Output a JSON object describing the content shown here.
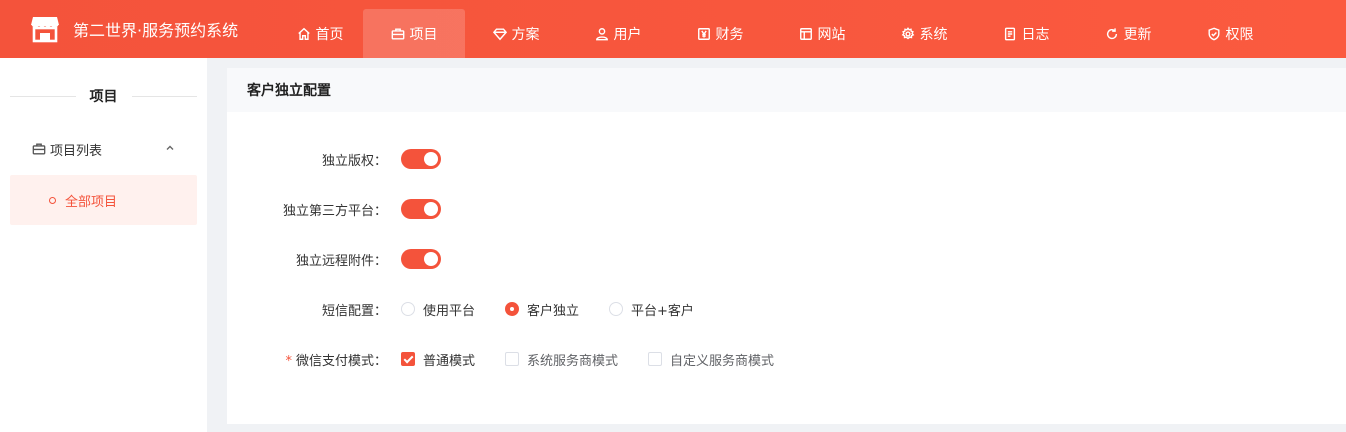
{
  "brand": {
    "title": "第二世界·服务预约系统"
  },
  "nav": {
    "items": [
      {
        "label": "首页",
        "icon": "home-icon"
      },
      {
        "label": "项目",
        "icon": "briefcase-icon",
        "active": true
      },
      {
        "label": "方案",
        "icon": "diamond-icon"
      },
      {
        "label": "用户",
        "icon": "user-icon"
      },
      {
        "label": "财务",
        "icon": "yen-icon"
      },
      {
        "label": "网站",
        "icon": "layout-icon"
      },
      {
        "label": "系统",
        "icon": "gear-icon"
      },
      {
        "label": "日志",
        "icon": "document-icon"
      },
      {
        "label": "更新",
        "icon": "refresh-icon"
      },
      {
        "label": "权限",
        "icon": "shield-icon"
      }
    ]
  },
  "sidebar": {
    "title": "项目",
    "group": {
      "label": "项目列表",
      "icon": "briefcase-icon",
      "expanded": true
    },
    "sub_item": {
      "label": "全部项目",
      "active": true
    }
  },
  "panel": {
    "title": "客户独立配置",
    "switches": [
      {
        "label": "独立版权：",
        "on": true
      },
      {
        "label": "独立第三方平台：",
        "on": true
      },
      {
        "label": "独立远程附件：",
        "on": true
      }
    ],
    "sms": {
      "label": "短信配置：",
      "options": [
        "使用平台",
        "客户独立",
        "平台+客户"
      ],
      "selected": "客户独立"
    },
    "wechat_pay": {
      "required_mark": "*",
      "label": "微信支付模式：",
      "options": [
        {
          "label": "普通模式",
          "checked": true
        },
        {
          "label": "系统服务商模式",
          "checked": false
        },
        {
          "label": "自定义服务商模式",
          "checked": false
        }
      ]
    }
  },
  "colors": {
    "accent": "#f4533b",
    "active_bg": "#fff1ee",
    "page_bg": "#f0f2f5"
  }
}
